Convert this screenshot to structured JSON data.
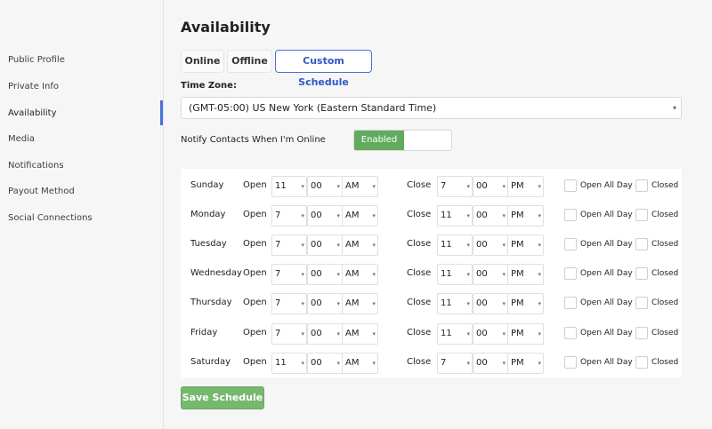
{
  "sidebar": {
    "items": [
      {
        "label": "Public Profile"
      },
      {
        "label": "Private Info"
      },
      {
        "label": "Availability"
      },
      {
        "label": "Media"
      },
      {
        "label": "Notifications"
      },
      {
        "label": "Payout Method"
      },
      {
        "label": "Social Connections"
      }
    ]
  },
  "page": {
    "title": "Availability"
  },
  "tabs": [
    {
      "label": "Online"
    },
    {
      "label": "Offline"
    },
    {
      "label": "Custom Schedule"
    }
  ],
  "timezone": {
    "label": "Time Zone:",
    "value": "(GMT-05:00) US New York (Eastern Standard Time)"
  },
  "notify": {
    "label": "Notify Contacts When I'm Online",
    "toggle_label": "Enabled"
  },
  "schedule": {
    "open_label": "Open",
    "close_label": "Close",
    "open_all_day_label": "Open All Day",
    "closed_label": "Closed",
    "days": [
      {
        "day": "Sunday",
        "open_h": "11",
        "open_m": "00",
        "open_ap": "AM",
        "close_h": "7",
        "close_m": "00",
        "close_ap": "PM"
      },
      {
        "day": "Monday",
        "open_h": "7",
        "open_m": "00",
        "open_ap": "AM",
        "close_h": "11",
        "close_m": "00",
        "close_ap": "PM"
      },
      {
        "day": "Tuesday",
        "open_h": "7",
        "open_m": "00",
        "open_ap": "AM",
        "close_h": "11",
        "close_m": "00",
        "close_ap": "PM"
      },
      {
        "day": "Wednesday",
        "open_h": "7",
        "open_m": "00",
        "open_ap": "AM",
        "close_h": "11",
        "close_m": "00",
        "close_ap": "PM"
      },
      {
        "day": "Thursday",
        "open_h": "7",
        "open_m": "00",
        "open_ap": "AM",
        "close_h": "11",
        "close_m": "00",
        "close_ap": "PM"
      },
      {
        "day": "Friday",
        "open_h": "7",
        "open_m": "00",
        "open_ap": "AM",
        "close_h": "11",
        "close_m": "00",
        "close_ap": "PM"
      },
      {
        "day": "Saturday",
        "open_h": "11",
        "open_m": "00",
        "open_ap": "AM",
        "close_h": "7",
        "close_m": "00",
        "close_ap": "PM"
      }
    ]
  },
  "save_button": {
    "label": "Save Schedule"
  },
  "colors": {
    "accent": "#4a6ee0",
    "success": "#62ab5e",
    "save_button": "#77b86f"
  },
  "icons": {
    "chevron": "chevron-down-icon"
  }
}
